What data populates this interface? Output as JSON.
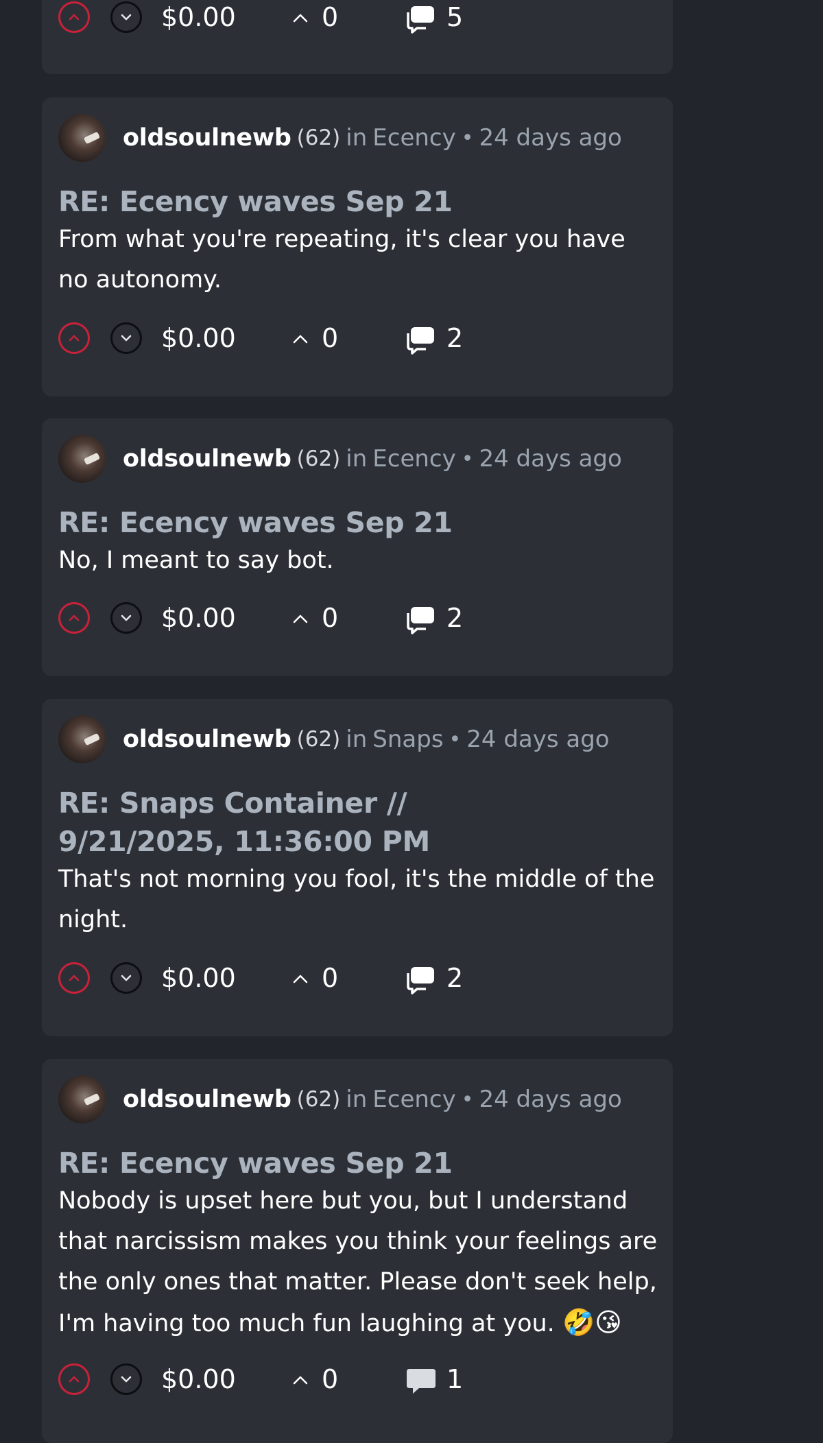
{
  "cards": [
    {
      "actions": {
        "payout": "$0.00",
        "votes": "0",
        "comments": "5"
      }
    },
    {
      "author": "oldsoulnewb",
      "reputation": "(62)",
      "community_prefix": "in",
      "community": "Ecency",
      "separator": "•",
      "age": "24 days ago",
      "title": "RE: Ecency waves Sep 21",
      "body": "From what you're repeating, it's clear you have no autonomy.",
      "actions": {
        "payout": "$0.00",
        "votes": "0",
        "comments": "2"
      }
    },
    {
      "author": "oldsoulnewb",
      "reputation": "(62)",
      "community_prefix": "in",
      "community": "Ecency",
      "separator": "•",
      "age": "24 days ago",
      "title": "RE: Ecency waves Sep 21",
      "body": "No, I meant to say bot.",
      "actions": {
        "payout": "$0.00",
        "votes": "0",
        "comments": "2"
      }
    },
    {
      "author": "oldsoulnewb",
      "reputation": "(62)",
      "community_prefix": "in",
      "community": "Snaps",
      "separator": "•",
      "age": "24 days ago",
      "title": "RE: Snaps Container // 9/21/2025, 11:36:00 PM",
      "body": "That's not morning you fool, it's the middle of the night.",
      "actions": {
        "payout": "$0.00",
        "votes": "0",
        "comments": "2"
      }
    },
    {
      "author": "oldsoulnewb",
      "reputation": "(62)",
      "community_prefix": "in",
      "community": "Ecency",
      "separator": "•",
      "age": "24 days ago",
      "title": "RE: Ecency waves Sep 21",
      "body": "Nobody is upset here but you, but I understand that narcissism makes you think your feelings are the only ones that matter. Please don't seek help, I'm having too much fun laughing at you.",
      "emojis": "🤣😘",
      "actions": {
        "payout": "$0.00",
        "votes": "0",
        "comments": "1"
      }
    }
  ],
  "colors": {
    "upvote": "#c9213a",
    "card": "#2c3036",
    "background": "#22262c",
    "title": "#aab3be",
    "meta": "#9aa3ae"
  },
  "icons": {
    "upvote": "chevron-up-circle-icon",
    "downvote": "chevron-down-circle-icon",
    "votes": "caret-up-icon",
    "comments": "comment-bubbles-icon"
  }
}
